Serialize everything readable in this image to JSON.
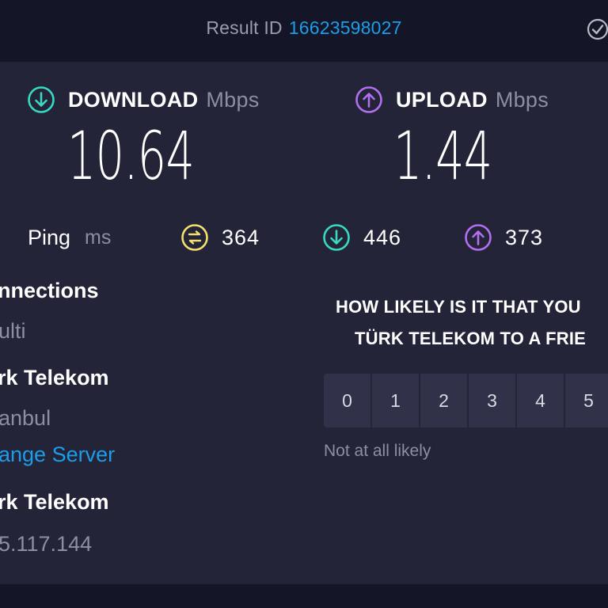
{
  "header": {
    "result_label": "Result ID",
    "result_id": "16623598027"
  },
  "download": {
    "label": "DOWNLOAD",
    "unit": "Mbps",
    "value": "10.64",
    "color": "#38d9c2"
  },
  "upload": {
    "label": "UPLOAD",
    "unit": "Mbps",
    "value": "1.44",
    "color": "#b36ff0"
  },
  "ping": {
    "label": "Ping",
    "unit": "ms",
    "idle": "364",
    "download": "446",
    "upload": "373",
    "idle_color": "#f4df6e"
  },
  "connection": {
    "title": "nnections",
    "mode": "ulti",
    "provider": "rk Telekom",
    "server_city": "anbul",
    "change_server": "ange Server",
    "isp": "rk Telekom",
    "ip": "5.117.144"
  },
  "survey": {
    "question_line1": "HOW LIKELY IS IT THAT YOU",
    "question_line2": "TÜRK TELEKOM TO A FRIE",
    "scale": [
      "0",
      "1",
      "2",
      "3",
      "4",
      "5"
    ],
    "hint_low": "Not at all likely"
  }
}
